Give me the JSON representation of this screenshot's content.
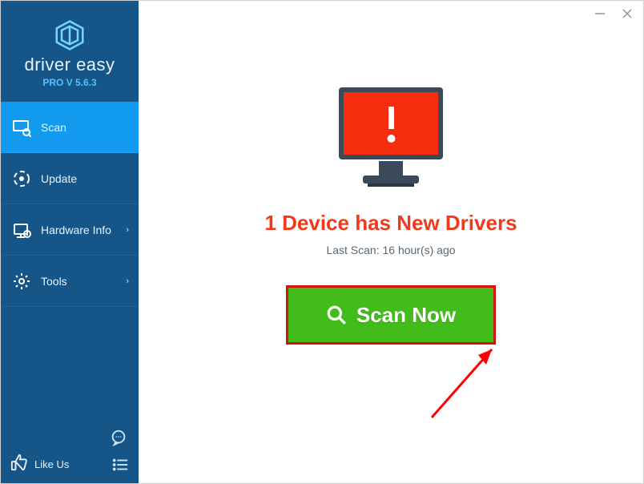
{
  "brand": {
    "name": "driver easy",
    "version": "PRO V 5.6.3"
  },
  "sidebar": {
    "items": [
      {
        "label": "Scan",
        "icon": "scan-icon",
        "has_caret": false,
        "active": true
      },
      {
        "label": "Update",
        "icon": "update-icon",
        "has_caret": false,
        "active": false
      },
      {
        "label": "Hardware Info",
        "icon": "hardware-icon",
        "has_caret": true,
        "active": false
      },
      {
        "label": "Tools",
        "icon": "tools-icon",
        "has_caret": true,
        "active": false
      }
    ],
    "likeus": "Like Us"
  },
  "main": {
    "status_title": "1 Device has New Drivers",
    "last_scan": "Last Scan: 16 hour(s) ago",
    "scan_button": "Scan Now"
  },
  "colors": {
    "sidebar_bg": "#165588",
    "sidebar_active": "#129aee",
    "status_red": "#f03a1b",
    "scan_green": "#41bc1a",
    "scan_border": "#d11507"
  }
}
